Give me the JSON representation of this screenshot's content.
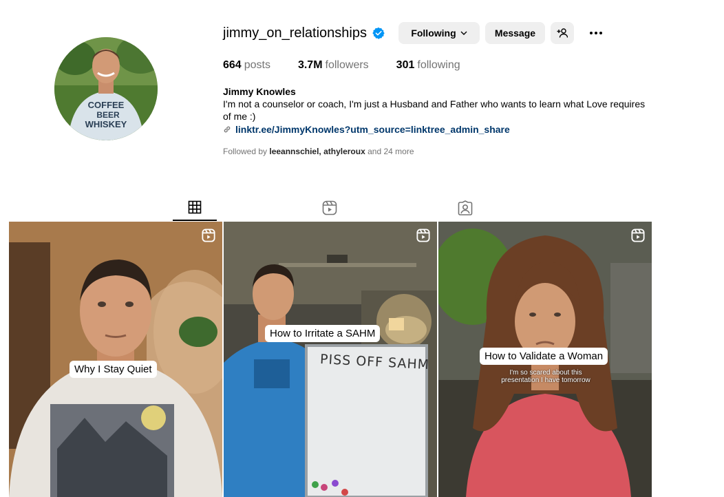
{
  "profile": {
    "username": "jimmy_on_relationships",
    "verified": true,
    "buttons": {
      "following": "Following",
      "message": "Message"
    },
    "icons": {
      "add_user": "add-user-icon",
      "more": "more-options-icon"
    },
    "stats": [
      {
        "num": "664",
        "label": "posts"
      },
      {
        "num": "3.7M",
        "label": "followers"
      },
      {
        "num": "301",
        "label": "following"
      }
    ],
    "full_name": "Jimmy Knowles",
    "bio": "I'm not a counselor or coach, I'm just a Husband and Father who wants to learn what Love requires of me :)",
    "link": "linktr.ee/JimmyKnowles?utm_source=linktree_admin_share",
    "followed_by": {
      "prefix": "Followed by",
      "names": "leeannschiel, athyleroux",
      "suffix": "and 24 more"
    },
    "avatar_shirt_text": [
      "COFFEE",
      "BEER",
      "WHISKEY"
    ]
  },
  "tabs": [
    {
      "name": "posts",
      "icon": "grid-icon",
      "active": true
    },
    {
      "name": "reels",
      "icon": "reels-icon",
      "active": false
    },
    {
      "name": "tagged",
      "icon": "tagged-icon",
      "active": false
    }
  ],
  "posts": [
    {
      "caption": "Why I Stay Quiet",
      "type": "reel"
    },
    {
      "caption": "How to Irritate a SAHM",
      "whiteboard_text": "PISS OFF SAHM",
      "type": "reel"
    },
    {
      "caption": "How to Validate a Woman",
      "subcaption": "I'm so scared about this presentation I have tomorrow",
      "type": "reel"
    }
  ],
  "colors": {
    "link": "#00376b",
    "verified": "#0095f6",
    "button_bg": "#efefef",
    "muted": "#737373"
  }
}
